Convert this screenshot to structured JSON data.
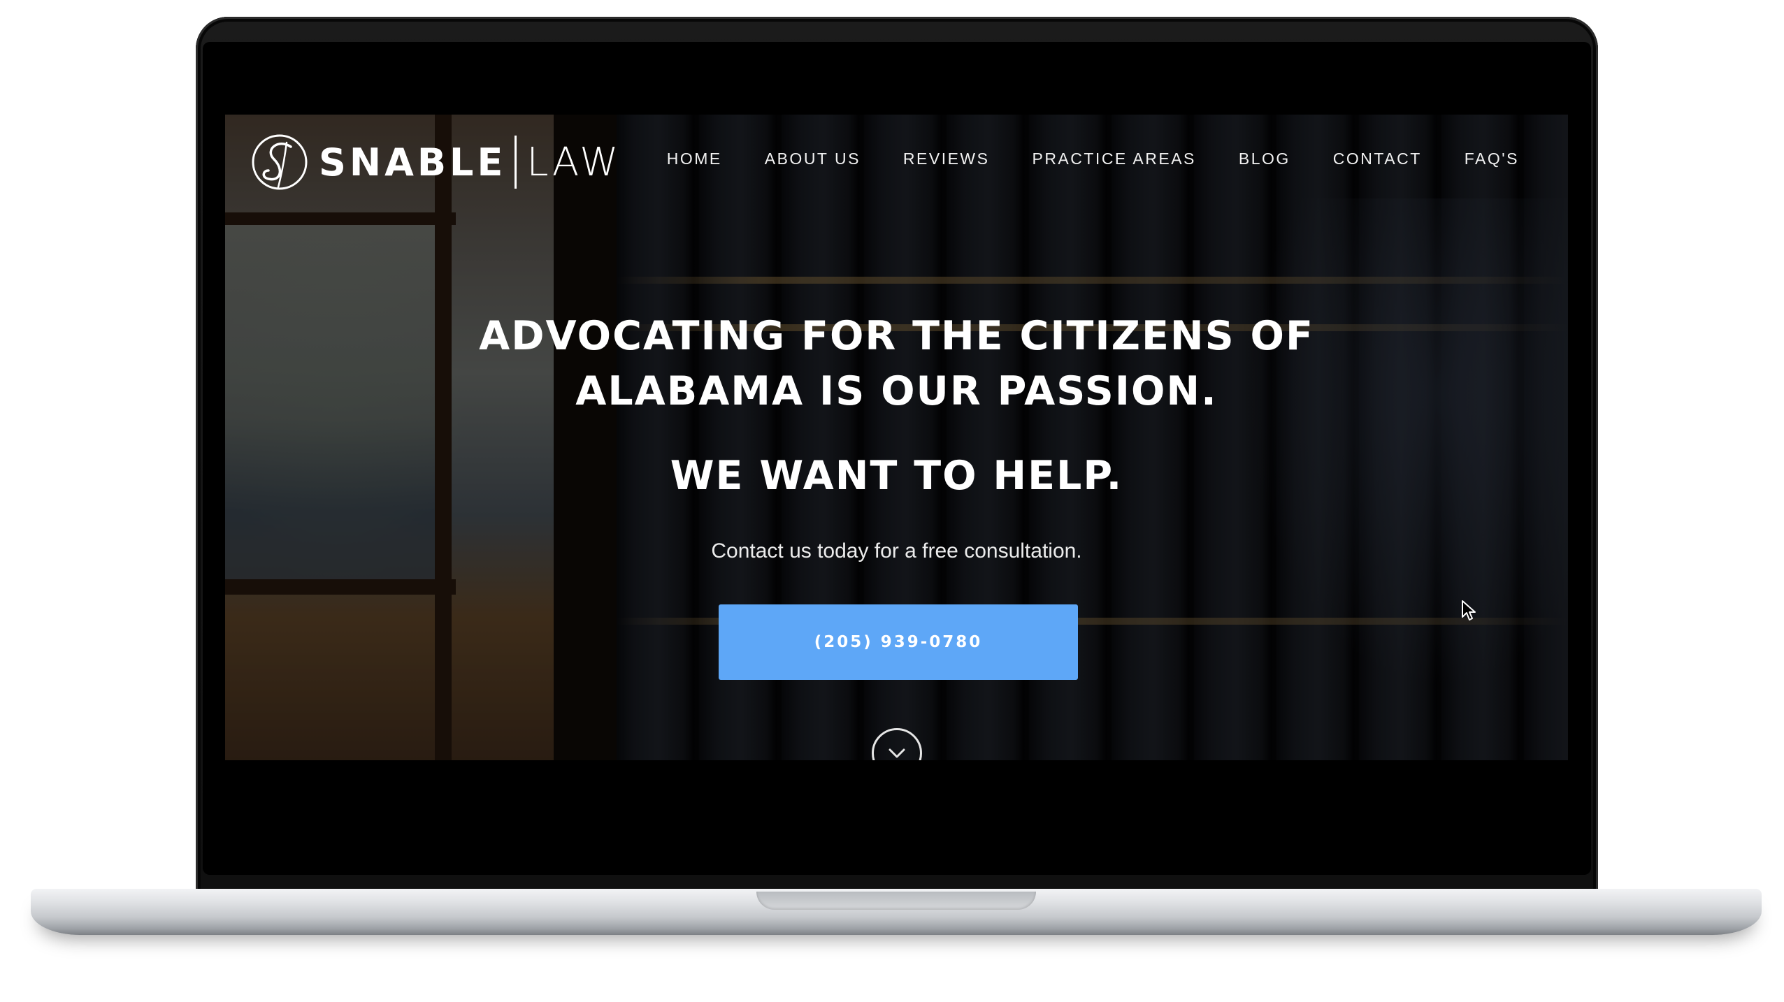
{
  "site": {
    "logo": {
      "word1": "SNABLE",
      "word2": "LAW"
    },
    "nav": [
      {
        "label": "HOME"
      },
      {
        "label": "ABOUT US"
      },
      {
        "label": "REVIEWS"
      },
      {
        "label": "PRACTICE AREAS"
      },
      {
        "label": "BLOG"
      },
      {
        "label": "CONTACT"
      },
      {
        "label": "FAQ'S"
      }
    ],
    "hero": {
      "title_line1": "ADVOCATING FOR THE CITIZENS OF",
      "title_line2": "ALABAMA IS OUR PASSION.",
      "subtitle": "WE WANT TO HELP.",
      "text": "Contact us today for a free consultation.",
      "cta_label": "(205) 939-0780"
    },
    "icons": {
      "scroll": "chevron-down-icon",
      "cursor": "mouse-pointer-icon"
    },
    "colors": {
      "cta": "#5ea7f7",
      "text": "#ffffff"
    }
  }
}
